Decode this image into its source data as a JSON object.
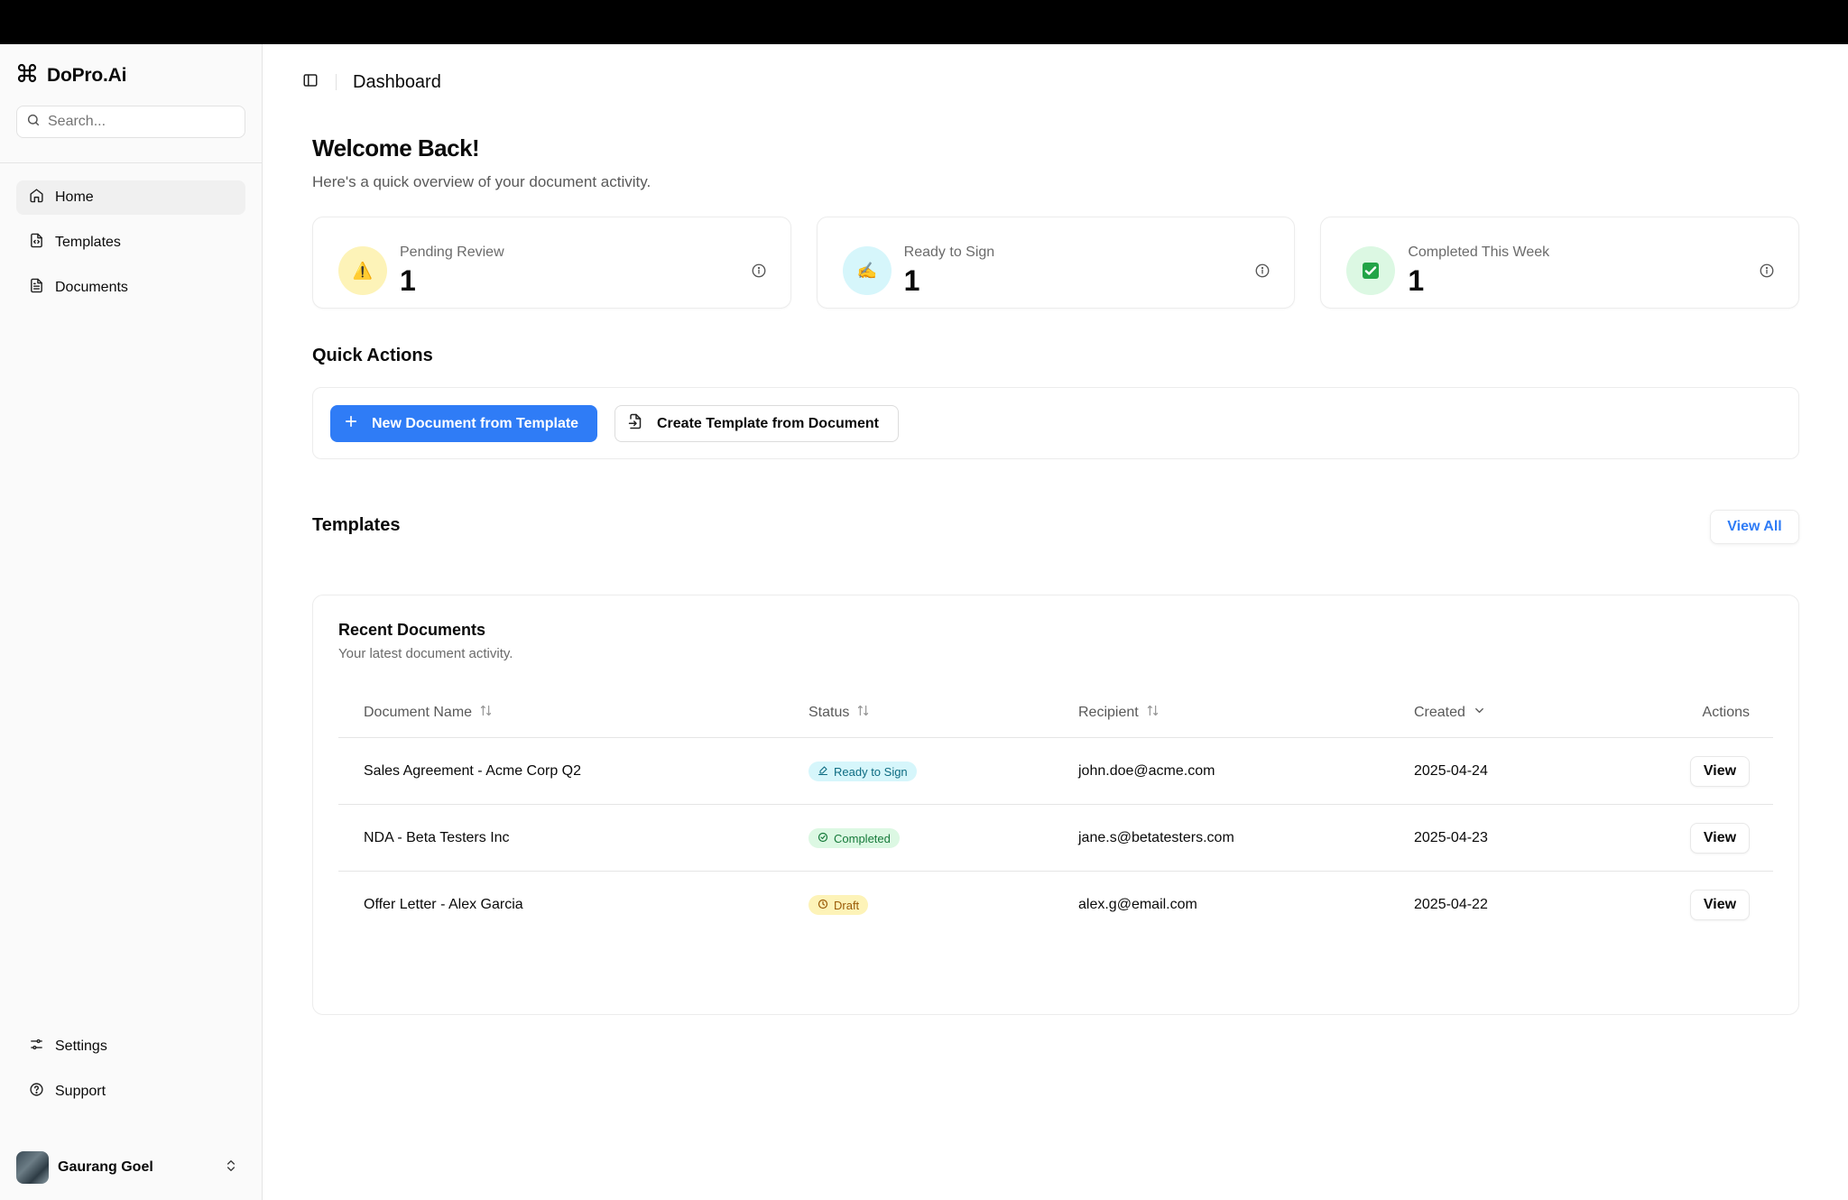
{
  "app": {
    "brand": "DoPro.Ai",
    "header_title": "Dashboard"
  },
  "sidebar": {
    "search_placeholder": "Search...",
    "items": [
      {
        "label": "Home",
        "icon": "home-icon",
        "active": true
      },
      {
        "label": "Templates",
        "icon": "file-code-icon",
        "active": false
      },
      {
        "label": "Documents",
        "icon": "file-text-icon",
        "active": false
      }
    ],
    "bottom_items": [
      {
        "label": "Settings",
        "icon": "sliders-icon"
      },
      {
        "label": "Support",
        "icon": "help-circle-icon"
      }
    ],
    "user": {
      "name": "Gaurang Goel"
    }
  },
  "welcome": {
    "title": "Welcome Back!",
    "subtitle": "Here's a quick overview of your document activity."
  },
  "stats": [
    {
      "label": "Pending Review",
      "value": "1",
      "icon": "warning-emoji-icon",
      "glyph": "⚠️",
      "color": "#fdf3b8"
    },
    {
      "label": "Ready to Sign",
      "value": "1",
      "icon": "writing-hand-emoji-icon",
      "glyph": "✍️",
      "color": "#d6f6fb"
    },
    {
      "label": "Completed This Week",
      "value": "1",
      "icon": "check-mark-emoji-icon",
      "glyph": "✅",
      "color": "#dcf8e3"
    }
  ],
  "quick_actions": {
    "title": "Quick Actions",
    "primary_label": "New Document from Template",
    "secondary_label": "Create Template from Document"
  },
  "templates": {
    "title": "Templates",
    "view_all_label": "View All"
  },
  "recent": {
    "title": "Recent Documents",
    "subtitle": "Your latest document activity.",
    "columns": [
      "Document Name",
      "Status",
      "Recipient",
      "Created",
      "Actions"
    ],
    "rows": [
      {
        "name": "Sales Agreement - Acme Corp Q2",
        "status": "Ready to Sign",
        "status_kind": "ready",
        "recipient": "john.doe@acme.com",
        "created": "2025-04-24",
        "action": "View"
      },
      {
        "name": "NDA - Beta Testers Inc",
        "status": "Completed",
        "status_kind": "completed",
        "recipient": "jane.s@betatesters.com",
        "created": "2025-04-23",
        "action": "View"
      },
      {
        "name": "Offer Letter - Alex Garcia",
        "status": "Draft",
        "status_kind": "draft",
        "recipient": "alex.g@email.com",
        "created": "2025-04-22",
        "action": "View"
      }
    ]
  },
  "colors": {
    "accent": "#2f7cf6",
    "ready_bg": "#d6f6fb",
    "ready_fg": "#0e6c82",
    "completed_bg": "#dcf8e3",
    "completed_fg": "#167a3a",
    "draft_bg": "#fdf3b8",
    "draft_fg": "#9a5a06"
  }
}
